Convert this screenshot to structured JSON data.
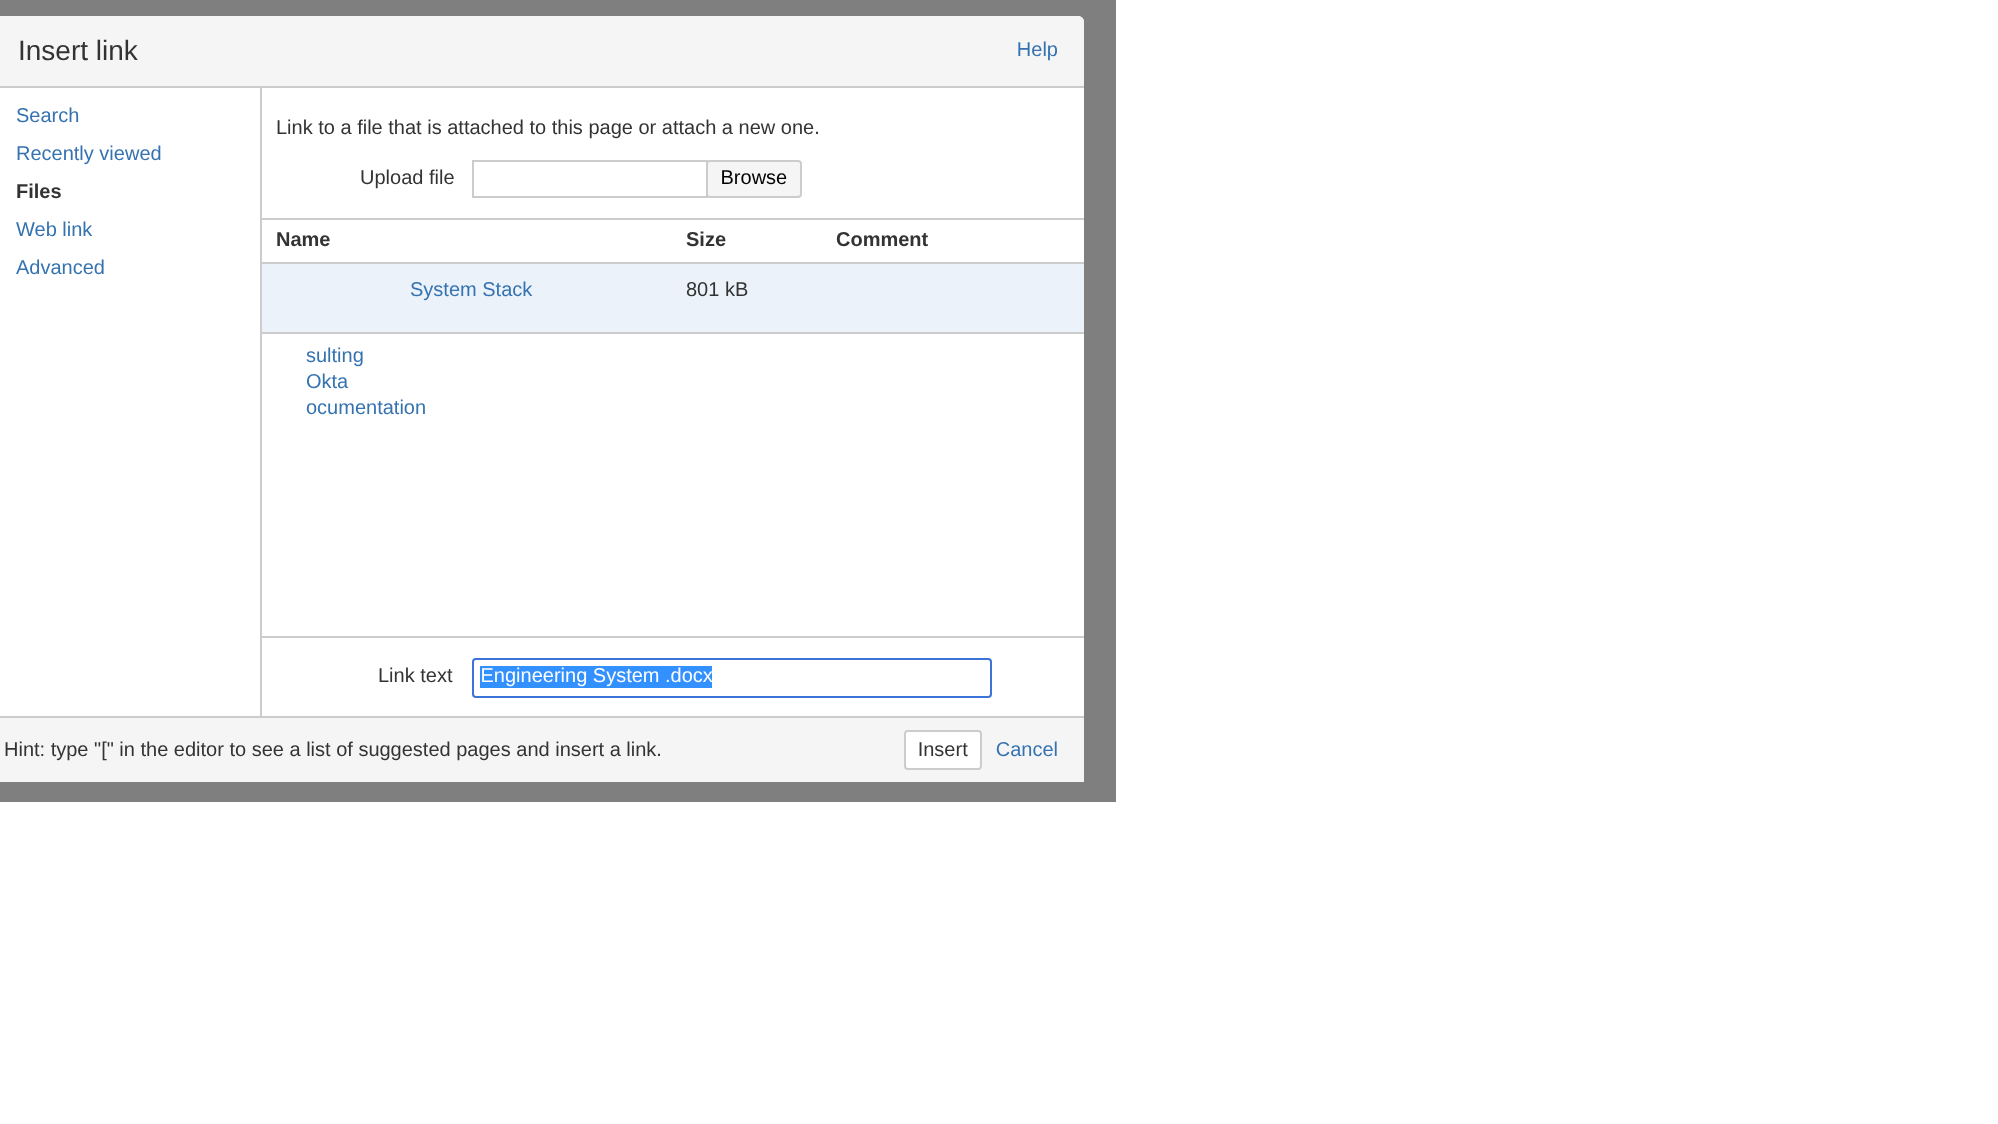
{
  "dialog": {
    "title": "Insert link",
    "help": "Help"
  },
  "sidebar": {
    "items": [
      {
        "label": "Search",
        "selected": false
      },
      {
        "label": "Recently viewed",
        "selected": false
      },
      {
        "label": "Files",
        "selected": true
      },
      {
        "label": "Web link",
        "selected": false
      },
      {
        "label": "Advanced",
        "selected": false
      }
    ]
  },
  "files": {
    "intro": "Link to a file that is attached to this page or attach a new one.",
    "upload": {
      "label": "Upload file",
      "button": "Browse"
    },
    "table": {
      "columns": [
        "Name",
        "Size",
        "Comment"
      ],
      "rows": [
        {
          "name": "System Stack",
          "size": "801 kB",
          "selected": true
        }
      ]
    },
    "links": [
      "sulting",
      "Okta",
      "ocumentation"
    ]
  },
  "link_text": {
    "label": "Link text",
    "value": "Engineering System .docx"
  },
  "footer": {
    "hint": "Hint: type \"[\" in the editor to see a list of suggested pages and insert a link.",
    "buttons": [
      "Insert",
      "Cancel"
    ]
  }
}
